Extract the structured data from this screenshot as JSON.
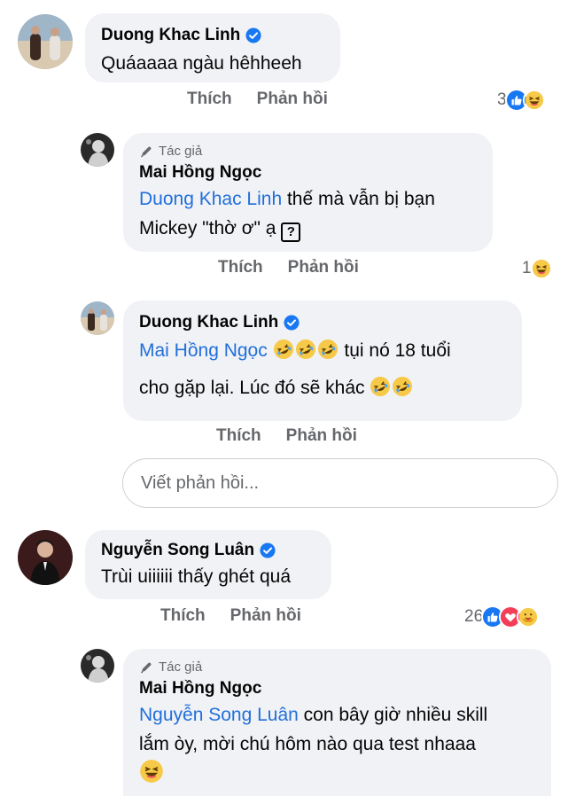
{
  "comments": [
    {
      "name": "Duong Khac Linh",
      "text": "Quáaaaa ngàu hêhheeh",
      "actions": {
        "like": "Thích",
        "reply": "Phản hồi"
      },
      "reaction_count": "3",
      "reaction_icons": [
        "like-icon",
        "haha-icon"
      ]
    },
    {
      "author_badge": "Tác giả",
      "name": "Mai Hồng Ngọc",
      "mention": "Duong Khac Linh",
      "text_line1": " thế mà vẫn bị bạn",
      "text_line2": "Mickey \"thờ ơ\" ạ ",
      "qbox": "?",
      "actions": {
        "like": "Thích",
        "reply": "Phản hồi"
      },
      "reaction_count": "1",
      "reaction_icons": [
        "haha-icon"
      ]
    },
    {
      "name": "Duong Khac Linh",
      "mention": "Mai Hồng Ngọc",
      "text_line1_tail": " tụi nó 18 tuổi",
      "text_line2": "cho gặp lại. Lúc đó sẽ khác ",
      "actions": {
        "like": "Thích",
        "reply": "Phản hồi"
      }
    },
    {
      "name": "Nguyễn Song Luân",
      "text": "Trùi uiiiiii thấy ghét quá",
      "actions": {
        "like": "Thích",
        "reply": "Phản hồi"
      },
      "reaction_count": "26",
      "reaction_icons": [
        "like-icon",
        "love-icon",
        "care-icon"
      ]
    },
    {
      "author_badge": "Tác giả",
      "name": "Mai Hồng Ngọc",
      "mention": "Nguyễn Song Luân",
      "text_line1": " con bây giờ nhiều skill",
      "text_line2": "lắm òy, mời chú hôm nào qua test nhaaa"
    }
  ],
  "reply_input": {
    "placeholder": "Viết phản hồi..."
  },
  "colors": {
    "mention": "#216fdb",
    "bubble": "#f0f2f5",
    "verified": "#1877f2",
    "muted": "#65676b"
  }
}
